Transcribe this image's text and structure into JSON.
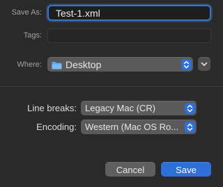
{
  "save_as": {
    "label": "Save As:",
    "value": "Test-1.xml"
  },
  "tags": {
    "label": "Tags:",
    "value": ""
  },
  "where": {
    "label": "Where:",
    "value": "Desktop",
    "icon": "folder-icon"
  },
  "line_breaks": {
    "label": "Line breaks:",
    "value": "Legacy Mac (CR)"
  },
  "encoding": {
    "label": "Encoding:",
    "value": "Western (Mac OS Ro..."
  },
  "buttons": {
    "cancel": "Cancel",
    "save": "Save"
  },
  "colors": {
    "accent": "#2f6fd6",
    "focus_ring": "#3a76c4",
    "background": "#2a2a2a"
  }
}
